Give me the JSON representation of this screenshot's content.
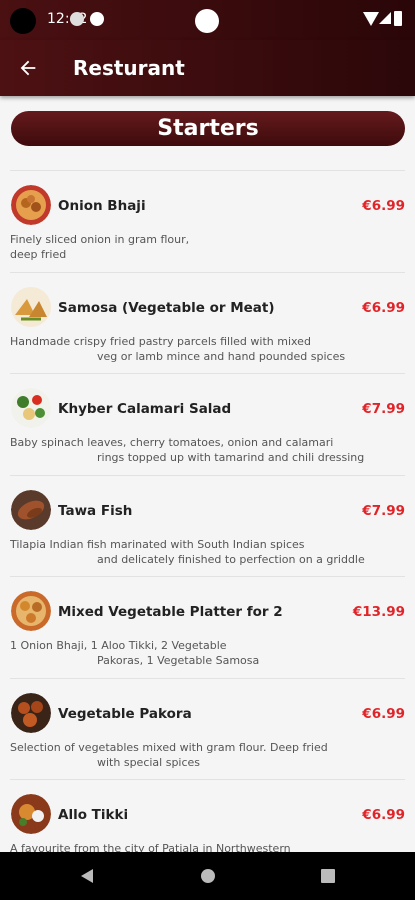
{
  "status_bar": {
    "time": "12:42"
  },
  "app_bar": {
    "title": "Resturant"
  },
  "section": {
    "title": "Starters"
  },
  "colors": {
    "brand_dark": "#3e0b0d",
    "price": "#e0252a"
  },
  "items": [
    {
      "name": "Onion Bhaji",
      "price": "€6.99",
      "desc1": "Finely sliced onion in gram flour,",
      "desc2": "deep fried",
      "indent": false,
      "icon": "onion-bhaji-image"
    },
    {
      "name": "Samosa (Vegetable or Meat)",
      "price": "€6.99",
      "desc1": "Handmade crispy fried pastry parcels filled with mixed",
      "desc2": "veg or lamb mince and hand pounded spices",
      "indent": true,
      "icon": "samosa-image"
    },
    {
      "name": "Khyber Calamari Salad",
      "price": "€7.99",
      "desc1": "Baby spinach leaves, cherry tomatoes, onion and calamari",
      "desc2": "rings topped up with tamarind and chili dressing",
      "indent": true,
      "icon": "calamari-salad-image"
    },
    {
      "name": "Tawa Fish",
      "price": "€7.99",
      "desc1": "Tilapia Indian fish marinated with South Indian spices",
      "desc2": "and delicately finished to perfection on a griddle",
      "indent": true,
      "icon": "tawa-fish-image"
    },
    {
      "name": "Mixed Vegetable Platter for 2",
      "price": "€13.99",
      "desc1": "1 Onion Bhaji, 1 Aloo Tikki, 2 Vegetable",
      "desc2": "Pakoras, 1 Vegetable Samosa",
      "indent": true,
      "icon": "vegetable-platter-image"
    },
    {
      "name": "Vegetable Pakora",
      "price": "€6.99",
      "desc1": "Selection of vegetables mixed with gram flour. Deep fried",
      "desc2": "with special spices",
      "indent": true,
      "icon": "vegetable-pakora-image"
    },
    {
      "name": "Allo Tikki",
      "price": "€6.99",
      "desc1": "A favourite from the city of Patiala in Northwestern",
      "desc2": "",
      "indent": false,
      "icon": "allo-tikki-image"
    }
  ]
}
